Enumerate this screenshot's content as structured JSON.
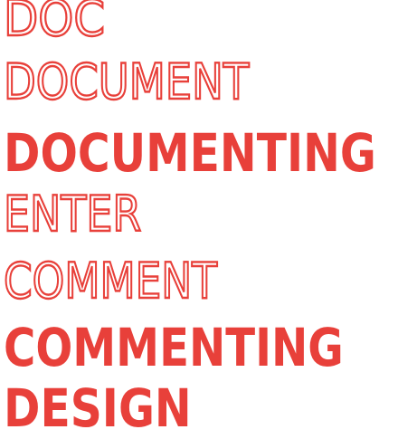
{
  "accent_color": "#e8403a",
  "words": [
    {
      "text": "DOC",
      "style": "outline"
    },
    {
      "text": "DOCUMENT",
      "style": "outline"
    },
    {
      "text": "DOCUMENTING",
      "style": "solid"
    },
    {
      "text": "ENTER",
      "style": "outline"
    },
    {
      "text": "COMMENT",
      "style": "outline"
    },
    {
      "text": "COMMENTING",
      "style": "solid"
    },
    {
      "text": "DESIGN",
      "style": "solid"
    }
  ]
}
